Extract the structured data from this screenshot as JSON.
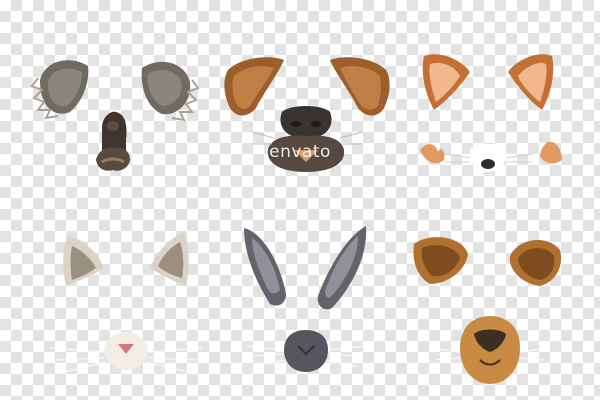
{
  "watermark": {
    "text": "envato"
  },
  "masks": [
    {
      "animal": "koala",
      "ear_color": "#7d7a6f",
      "nose_color": "#4a3f36"
    },
    {
      "animal": "dog",
      "ear_color": "#b8743c",
      "nose_color": "#3e3633"
    },
    {
      "animal": "fox",
      "ear_color": "#d98c4e",
      "nose_color": "#2e2e2e"
    },
    {
      "animal": "cat",
      "ear_color": "#e8e4dc",
      "nose_color": "#d9747c"
    },
    {
      "animal": "rabbit",
      "ear_color": "#6d6e76",
      "nose_color": "#5f6068"
    },
    {
      "animal": "lion",
      "ear_color": "#c6883c",
      "nose_color": "#3d2e24"
    }
  ]
}
